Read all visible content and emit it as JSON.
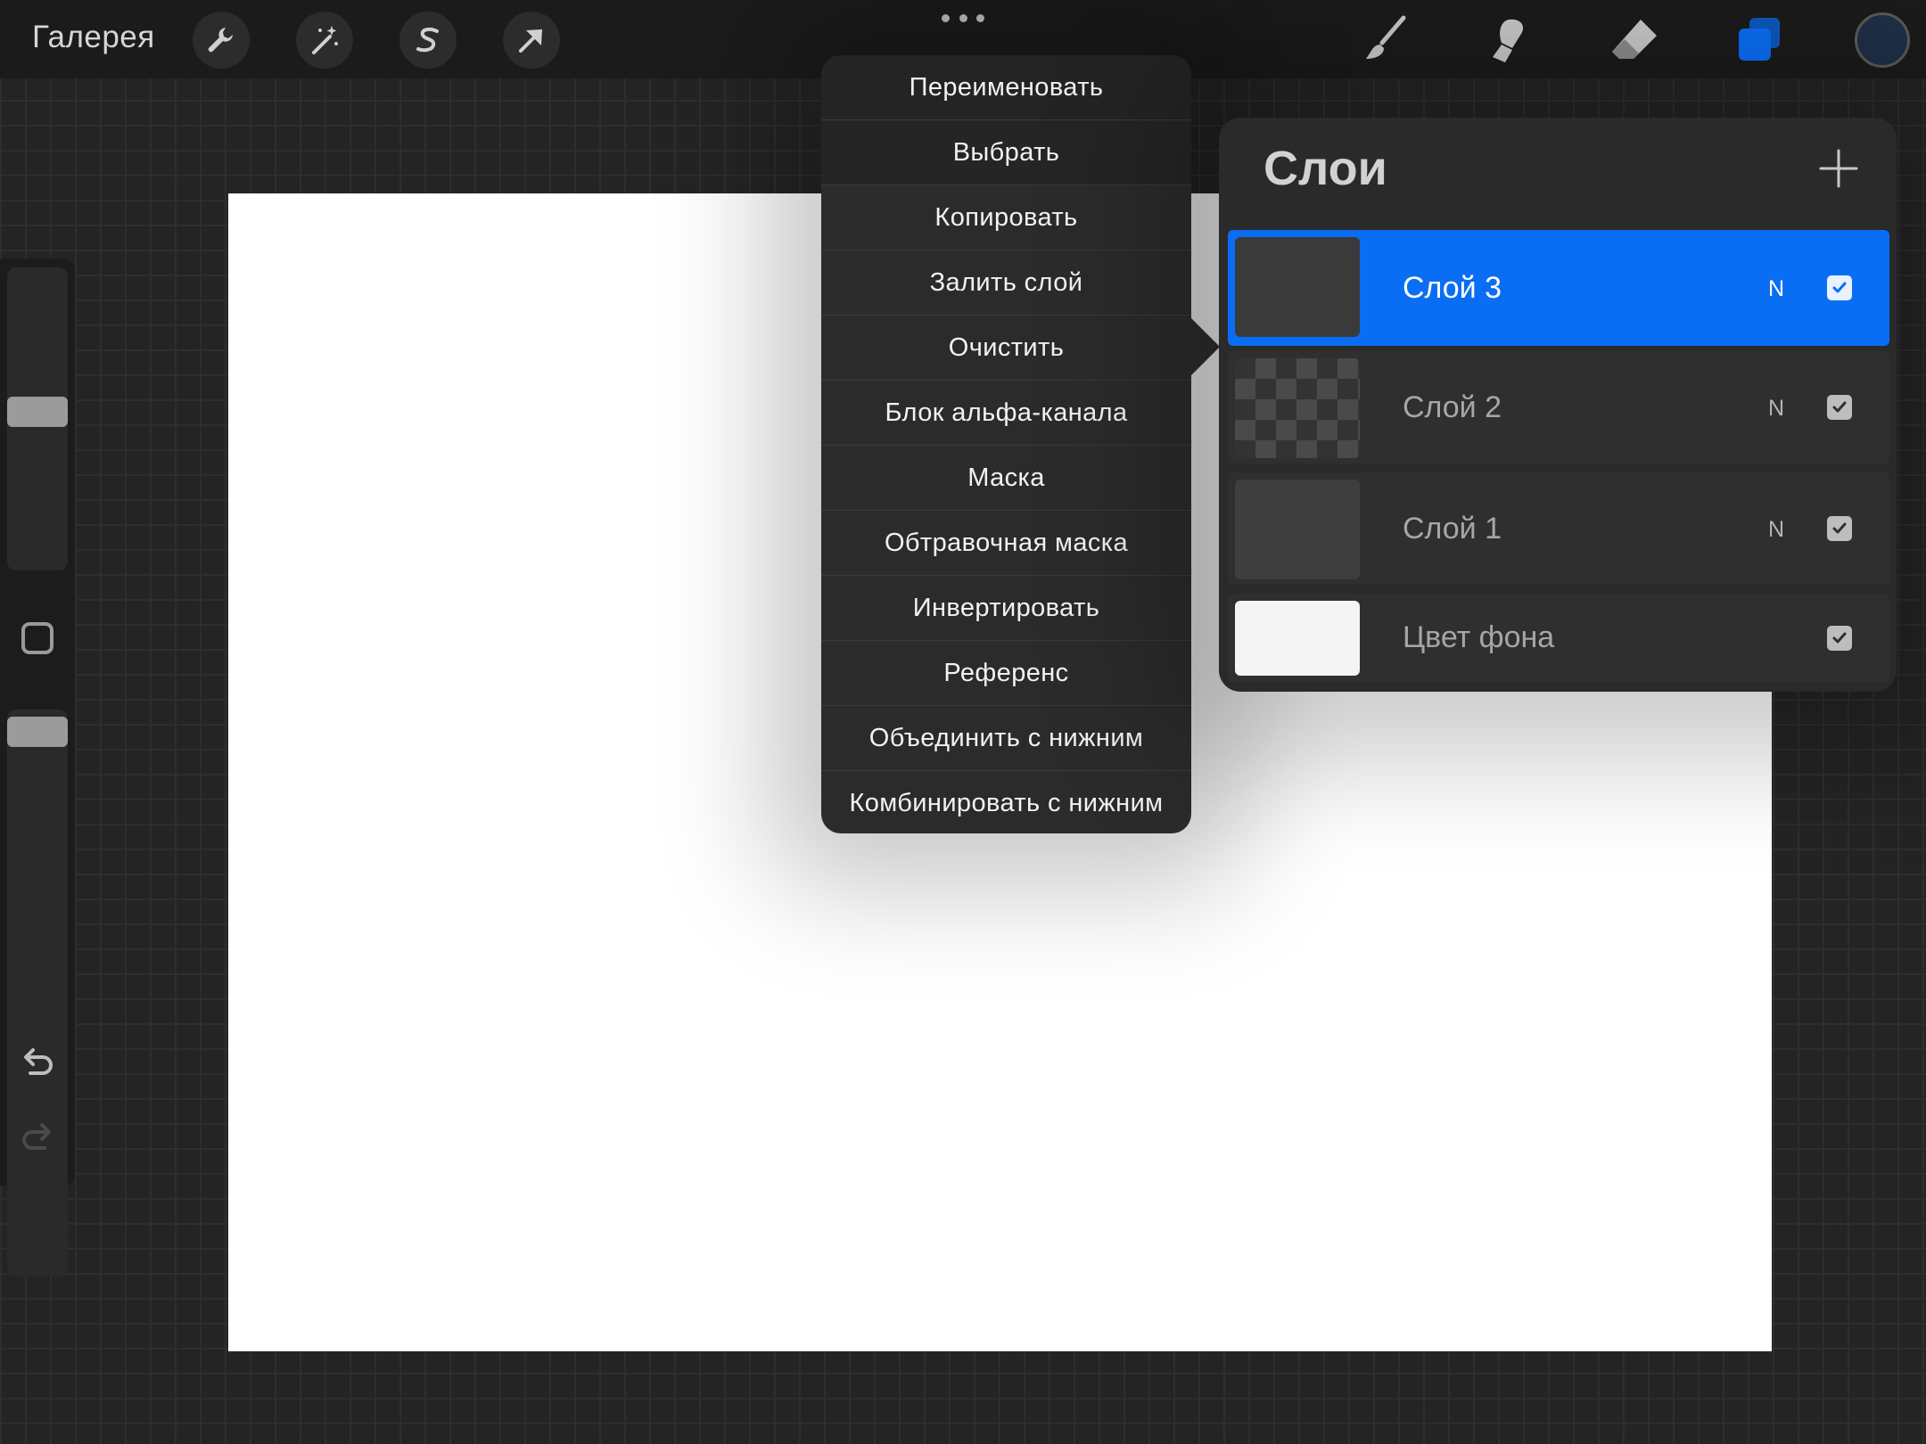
{
  "topbar": {
    "gallery_label": "Галерея",
    "left_tools": [
      "wrench-icon",
      "magic-wand-icon",
      "selection-icon",
      "transform-arrow-icon"
    ],
    "right_tools": [
      "brush-icon",
      "smudge-icon",
      "eraser-icon",
      "layers-icon"
    ],
    "active_color": "#1f3048",
    "accent_color": "#0a6ef5"
  },
  "sidebar": {
    "brush_size_level": 0.33,
    "opacity_level": 0.1,
    "undo_icon": "undo-icon",
    "redo_icon": "redo-icon"
  },
  "layer_actions_menu": {
    "items": [
      "Переименовать",
      "Выбрать",
      "Копировать",
      "Залить слой",
      "Очистить",
      "Блок альфа-канала",
      "Маска",
      "Обтравочная маска",
      "Инвертировать",
      "Референс",
      "Объединить с нижним",
      "Комбинировать с нижним"
    ]
  },
  "layers_panel": {
    "title": "Слои",
    "add_icon": "plus-icon",
    "layers": [
      {
        "name": "Слой 3",
        "blend": "N",
        "visible": true,
        "selected": true
      },
      {
        "name": "Слой 2",
        "blend": "N",
        "visible": true,
        "selected": false
      },
      {
        "name": "Слой 1",
        "blend": "N",
        "visible": true,
        "selected": false
      },
      {
        "name": "Цвет фона",
        "blend": "",
        "visible": true,
        "selected": false
      }
    ]
  }
}
